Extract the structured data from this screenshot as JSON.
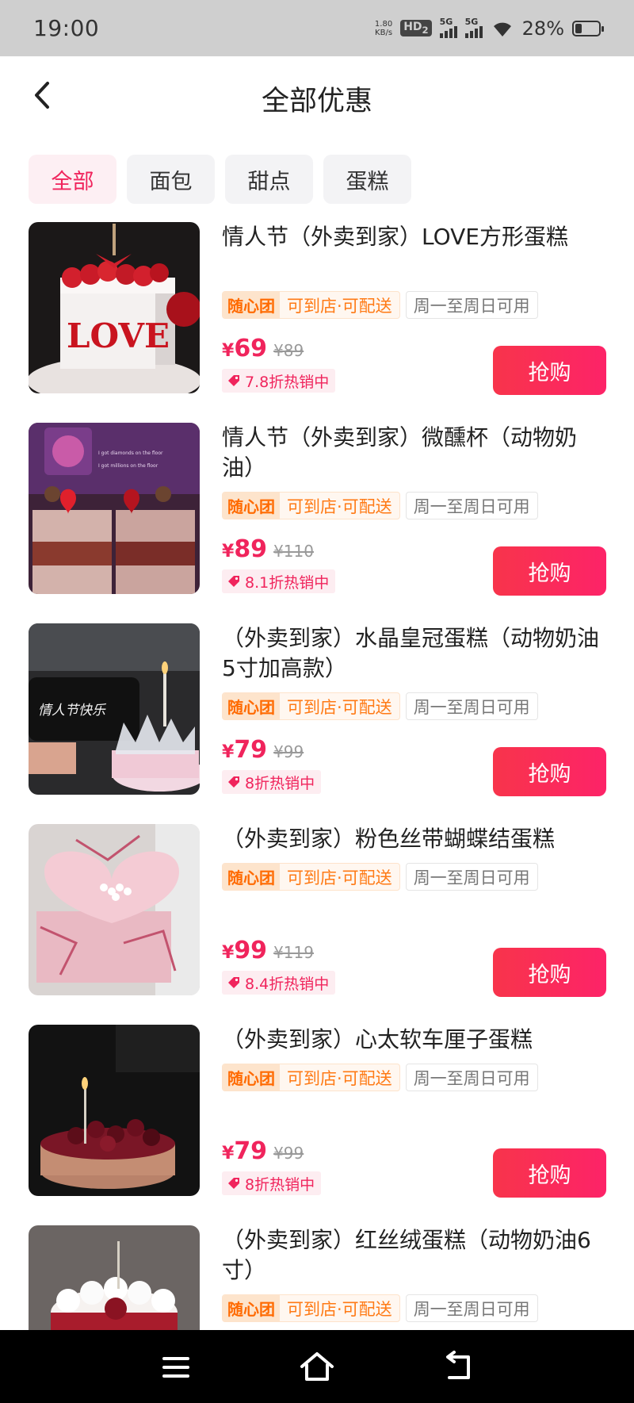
{
  "status_bar": {
    "time": "19:00",
    "net_speed_value": "1.80",
    "net_speed_unit": "KB/s",
    "hd": "HD",
    "hd_sub": "2",
    "signal_1": "5G",
    "signal_2": "5G",
    "battery": "28%",
    "battery_level": 0.28
  },
  "header": {
    "title": "全部优惠"
  },
  "tabs": [
    {
      "label": "全部",
      "active": true
    },
    {
      "label": "面包",
      "active": false
    },
    {
      "label": "甜点",
      "active": false
    },
    {
      "label": "蛋糕",
      "active": false
    }
  ],
  "items": [
    {
      "title": "情人节（外卖到家）LOVE方形蛋糕",
      "brand_tag": "随心团",
      "mode_tag": "可到店·可配送",
      "days_tag": "周一至周日可用",
      "currency": "¥",
      "price": "69",
      "original_price": "¥89",
      "discount": "7.8折热销中",
      "button": "抢购"
    },
    {
      "title": "情人节（外卖到家）微醺杯（动物奶油）",
      "brand_tag": "随心团",
      "mode_tag": "可到店·可配送",
      "days_tag": "周一至周日可用",
      "currency": "¥",
      "price": "89",
      "original_price": "¥110",
      "discount": "8.1折热销中",
      "button": "抢购"
    },
    {
      "title": "（外卖到家）水晶皇冠蛋糕（动物奶油5寸加高款）",
      "brand_tag": "随心团",
      "mode_tag": "可到店·可配送",
      "days_tag": "周一至周日可用",
      "currency": "¥",
      "price": "79",
      "original_price": "¥99",
      "discount": "8折热销中",
      "button": "抢购"
    },
    {
      "title": "（外卖到家）粉色丝带蝴蝶结蛋糕",
      "brand_tag": "随心团",
      "mode_tag": "可到店·可配送",
      "days_tag": "周一至周日可用",
      "currency": "¥",
      "price": "99",
      "original_price": "¥119",
      "discount": "8.4折热销中",
      "button": "抢购"
    },
    {
      "title": "（外卖到家）心太软车厘子蛋糕",
      "brand_tag": "随心团",
      "mode_tag": "可到店·可配送",
      "days_tag": "周一至周日可用",
      "currency": "¥",
      "price": "79",
      "original_price": "¥99",
      "discount": "8折热销中",
      "button": "抢购"
    },
    {
      "title": "（外卖到家）红丝绒蛋糕（动物奶油6寸）",
      "brand_tag": "随心团",
      "mode_tag": "可到店·可配送",
      "days_tag": "周一至周日可用"
    }
  ],
  "thumb_image_text": {
    "love": "LOVE",
    "card": "情人节快乐",
    "cup_lines": [
      "I got diamonds on the floor",
      "I got millions on the floor"
    ]
  },
  "colors": {
    "accent": "#f0245c",
    "brand_tag": "#ff6a00",
    "tab_active_bg": "#fdeff3",
    "button_gradient_start": "#f8344b",
    "button_gradient_end": "#fd2368"
  },
  "icons": {
    "back": "chevron-left-icon",
    "discount": "tag-icon",
    "nav_menu": "menu-icon",
    "nav_home": "home-icon",
    "nav_back": "back-arrow-icon"
  }
}
